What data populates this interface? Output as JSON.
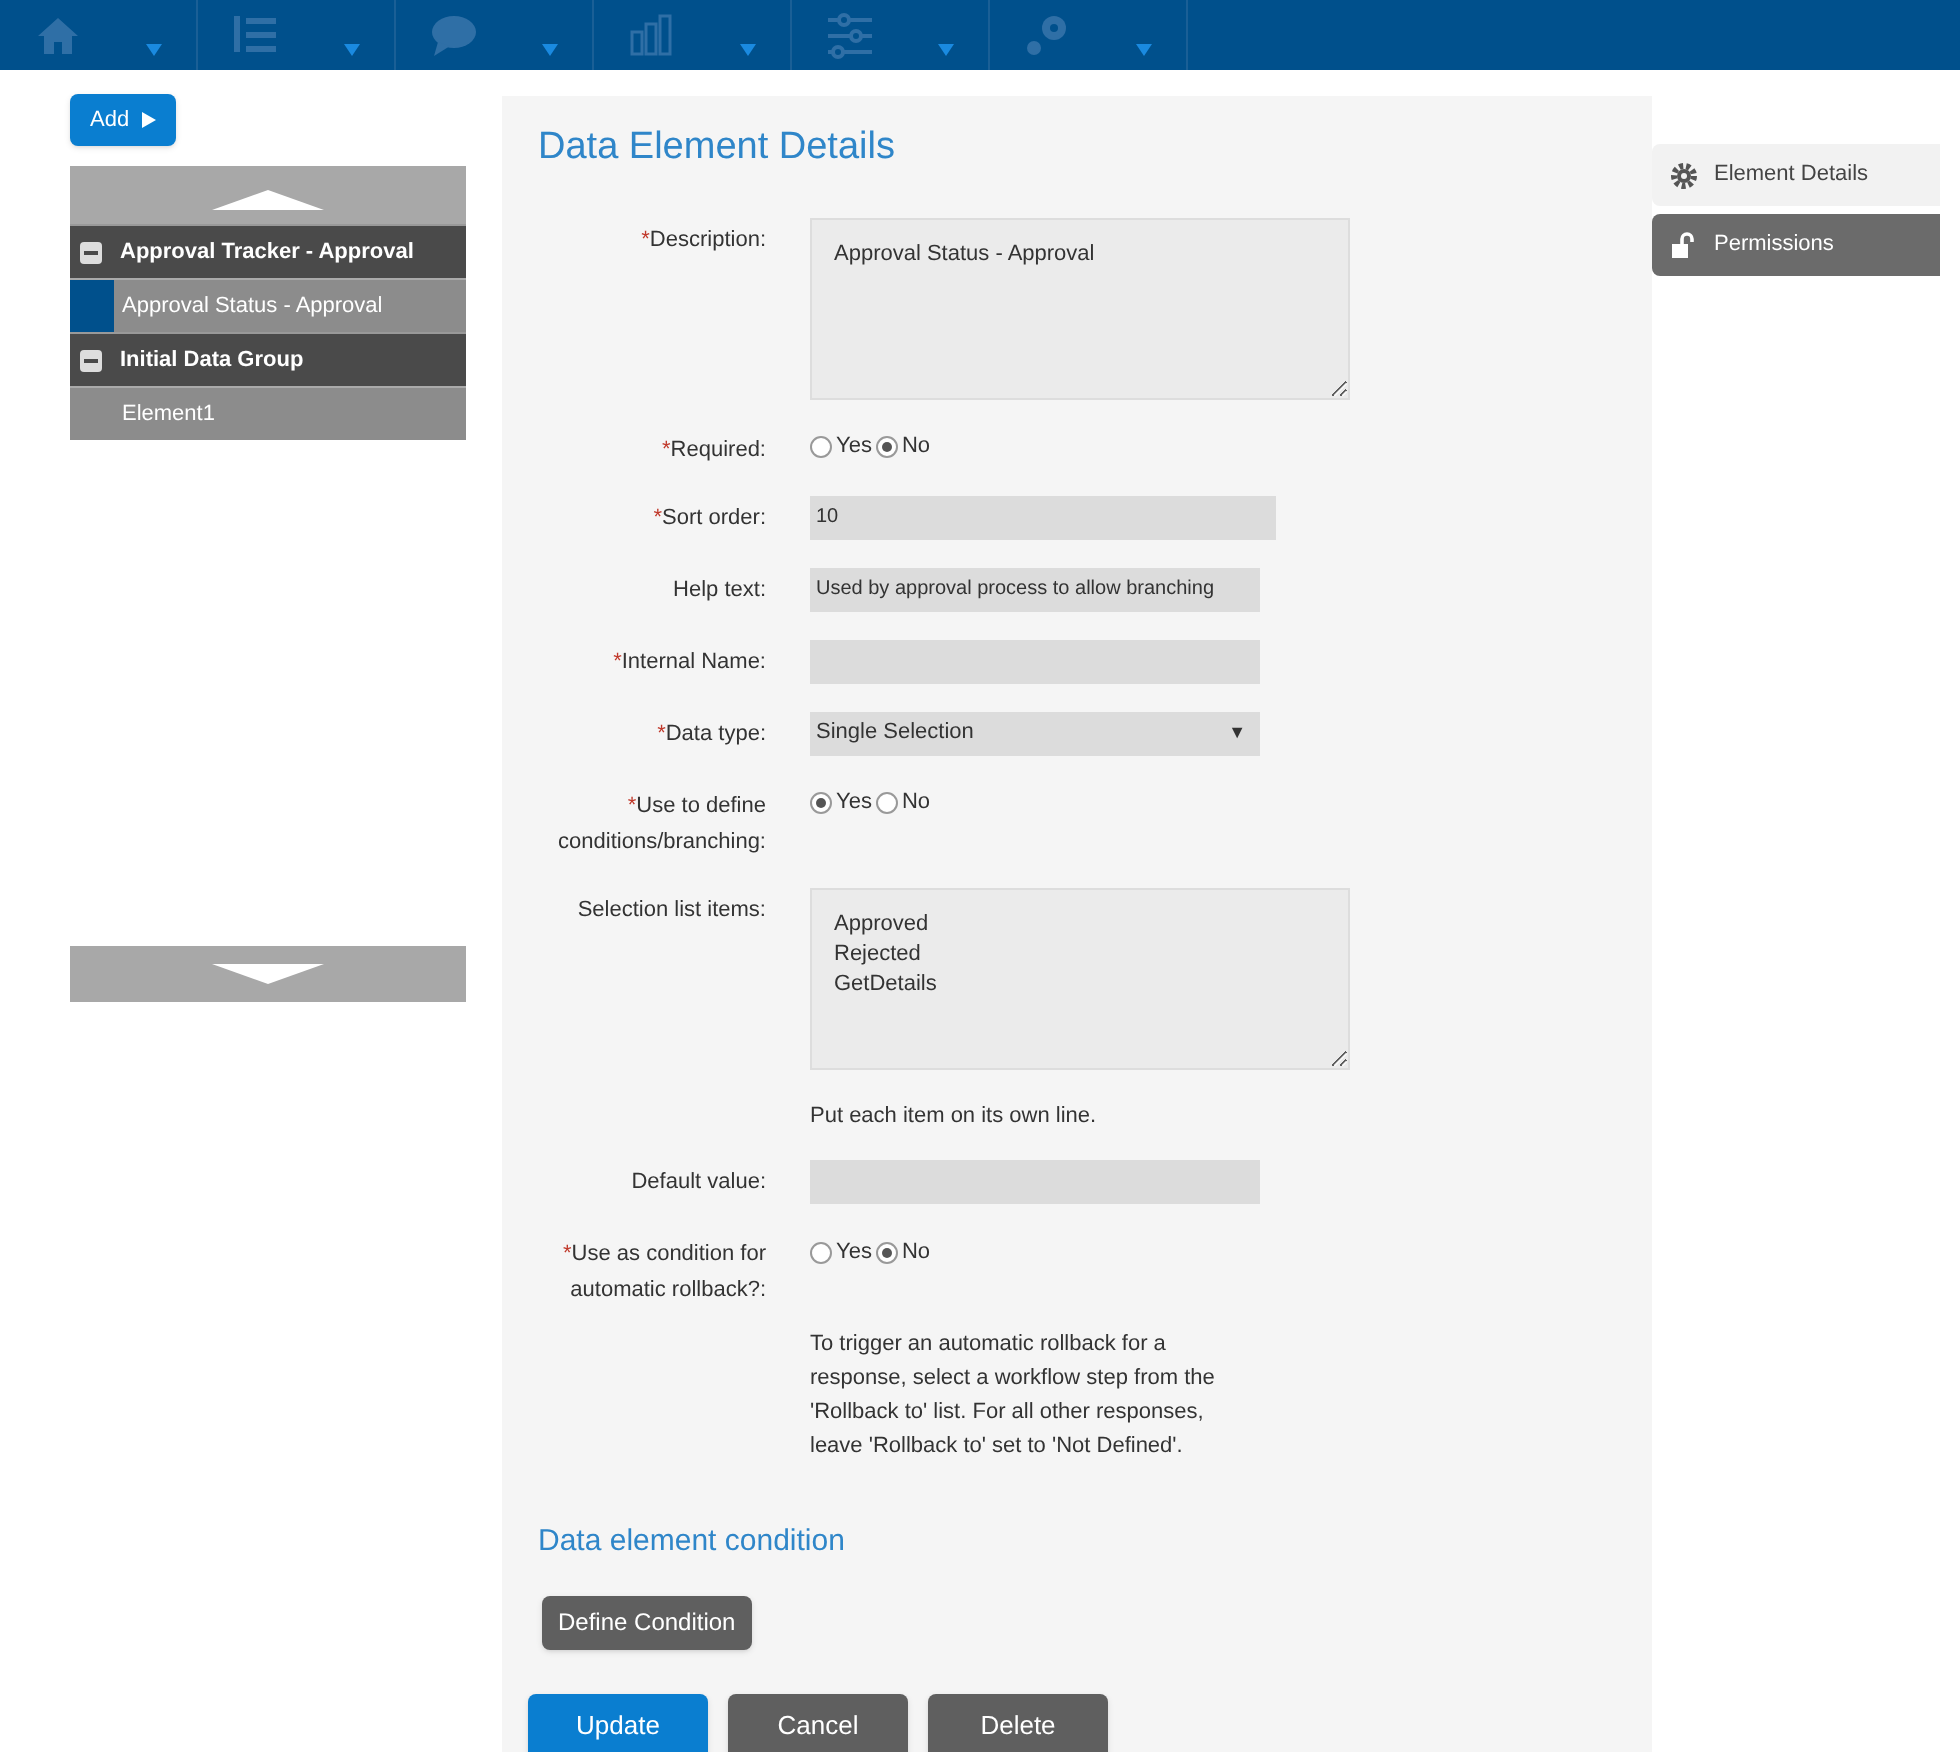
{
  "nav": [
    {
      "kind": "home"
    },
    {
      "kind": "list"
    },
    {
      "kind": "chat"
    },
    {
      "kind": "chart"
    },
    {
      "kind": "sliders"
    },
    {
      "kind": "gears"
    }
  ],
  "sidebar": {
    "add_button": "Add",
    "tree": [
      {
        "label": "Approval Tracker - Approval",
        "expanded": true,
        "children": [
          {
            "label": "Approval Status - Approval",
            "selected": true
          }
        ]
      },
      {
        "label": "Initial Data Group",
        "expanded": true,
        "children": [
          {
            "label": "Element1",
            "selected": false
          }
        ]
      }
    ]
  },
  "main": {
    "title": "Data Element Details",
    "fields": [
      {
        "kind": "textarea",
        "required_mark": "*",
        "label": "Description:",
        "value": "Approval Status - Approval"
      },
      {
        "kind": "radio",
        "required_mark": "*",
        "label": "Required:",
        "options": [
          {
            "label": "Yes",
            "selected": false
          },
          {
            "label": "No",
            "selected": true
          }
        ]
      },
      {
        "kind": "text",
        "required_mark": "*",
        "label": "Sort order:",
        "value": "10"
      },
      {
        "kind": "text",
        "label": "Help text:",
        "value": "Used by approval process to allow branching"
      },
      {
        "kind": "text",
        "required_mark": "*",
        "label": "Internal Name:"
      },
      {
        "kind": "select",
        "required_mark": "*",
        "label": "Data type:",
        "value": "Single Selection",
        "caret": "▼"
      },
      {
        "kind": "radio",
        "required_mark": "*",
        "label": "Use to define conditions/branching:",
        "options": [
          {
            "label": "Yes",
            "selected": true
          },
          {
            "label": "No",
            "selected": false
          }
        ]
      },
      {
        "kind": "textarea",
        "label": "Selection list items:",
        "value": "Approved\nRejected\nGetDetails",
        "hint": "Put each item on its own line."
      },
      {
        "kind": "text",
        "label": "Default value:"
      },
      {
        "kind": "radio",
        "required_mark": "*",
        "label": "Use as condition for automatic rollback?:",
        "options": [
          {
            "label": "Yes",
            "selected": false
          },
          {
            "label": "No",
            "selected": true
          }
        ],
        "note": "To trigger an automatic rollback for a response, select a workflow step from the 'Rollback to' list. For all other responses, leave 'Rollback to' set to 'Not Defined'."
      }
    ],
    "section_title": "Data element condition",
    "define_button": "Define Condition",
    "actions": [
      {
        "label": "Update",
        "kind": "primary"
      },
      {
        "label": "Cancel",
        "kind": "secondary"
      },
      {
        "label": "Delete",
        "kind": "secondary"
      }
    ]
  },
  "right_tabs": [
    {
      "label": "Element Details",
      "kind": "gear",
      "selected": true
    },
    {
      "label": "Permissions",
      "kind": "lock",
      "selected": false
    }
  ]
}
